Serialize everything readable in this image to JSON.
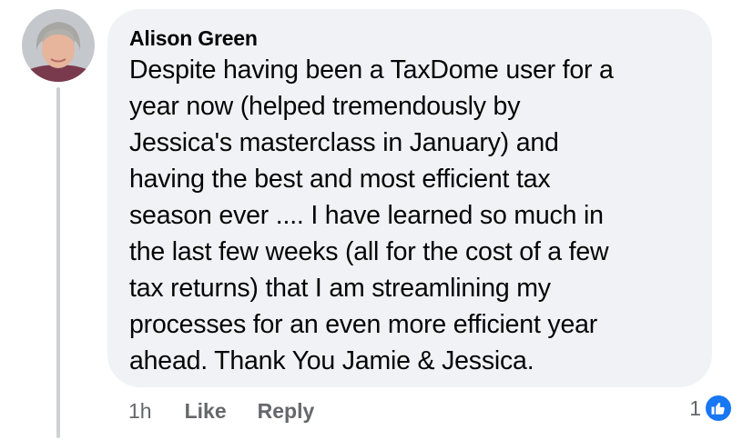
{
  "comment": {
    "author": "Alison Green",
    "text": "Despite having been a TaxDome user for a\nyear now (helped tremendously by\nJessica's masterclass in January) and\nhaving the best and most efficient tax\nseason ever .... I have learned so much in\nthe last few weeks (all for the cost of a few\ntax returns) that I am streamlining my\nprocesses for an even more efficient year\nahead. Thank You Jamie & Jessica.",
    "timestamp": "1h",
    "like_label": "Like",
    "reply_label": "Reply",
    "reaction_count": "1",
    "reaction_icon": "thumbs-up-icon"
  },
  "colors": {
    "bubble_background": "#f0f2f5",
    "text": "#050505",
    "secondary_text": "#65676b",
    "reaction_blue": "#1877f2",
    "thread_line": "#ced0d4"
  }
}
